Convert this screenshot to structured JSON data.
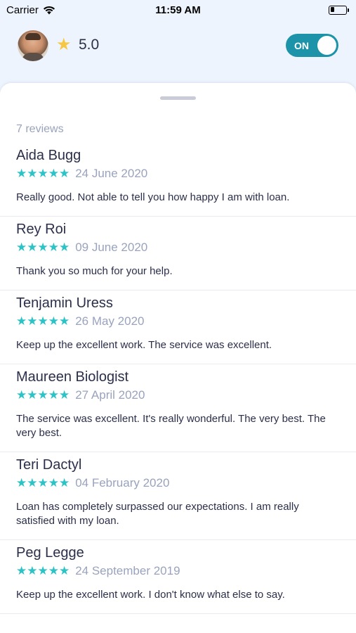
{
  "status_bar": {
    "carrier": "Carrier",
    "time": "11:59 AM",
    "battery_level": 0.25
  },
  "header": {
    "rating_icon": "star-icon",
    "rating": "5.0",
    "toggle_label": "ON",
    "toggle_on": true
  },
  "reviews": {
    "count_label": "7 reviews",
    "star_color": "#2cc3c7",
    "items": [
      {
        "name": "Aida Bugg",
        "stars": "★★★★★",
        "rating": 5,
        "date": "24 June 2020",
        "text": "Really good. Not able to tell you how happy I am with loan."
      },
      {
        "name": "Rey Roi",
        "stars": "★★★★★",
        "rating": 5,
        "date": "09 June 2020",
        "text": "Thank you so much for your help."
      },
      {
        "name": "Tenjamin Uress",
        "stars": "★★★★★",
        "rating": 5,
        "date": "26 May 2020",
        "text": "Keep up the excellent work. The service was excellent."
      },
      {
        "name": "Maureen Biologist",
        "stars": "★★★★★",
        "rating": 5,
        "date": "27 April 2020",
        "text": "The service was excellent. It's really wonderful. The very best. The very best."
      },
      {
        "name": "Teri Dactyl",
        "stars": "★★★★★",
        "rating": 5,
        "date": "04 February 2020",
        "text": "Loan has completely surpassed our expectations. I am really satisfied with my loan."
      },
      {
        "name": "Peg Legge",
        "stars": "★★★★★",
        "rating": 5,
        "date": "24 September 2019",
        "text": "Keep up the excellent work. I don't know what else to say."
      }
    ]
  }
}
